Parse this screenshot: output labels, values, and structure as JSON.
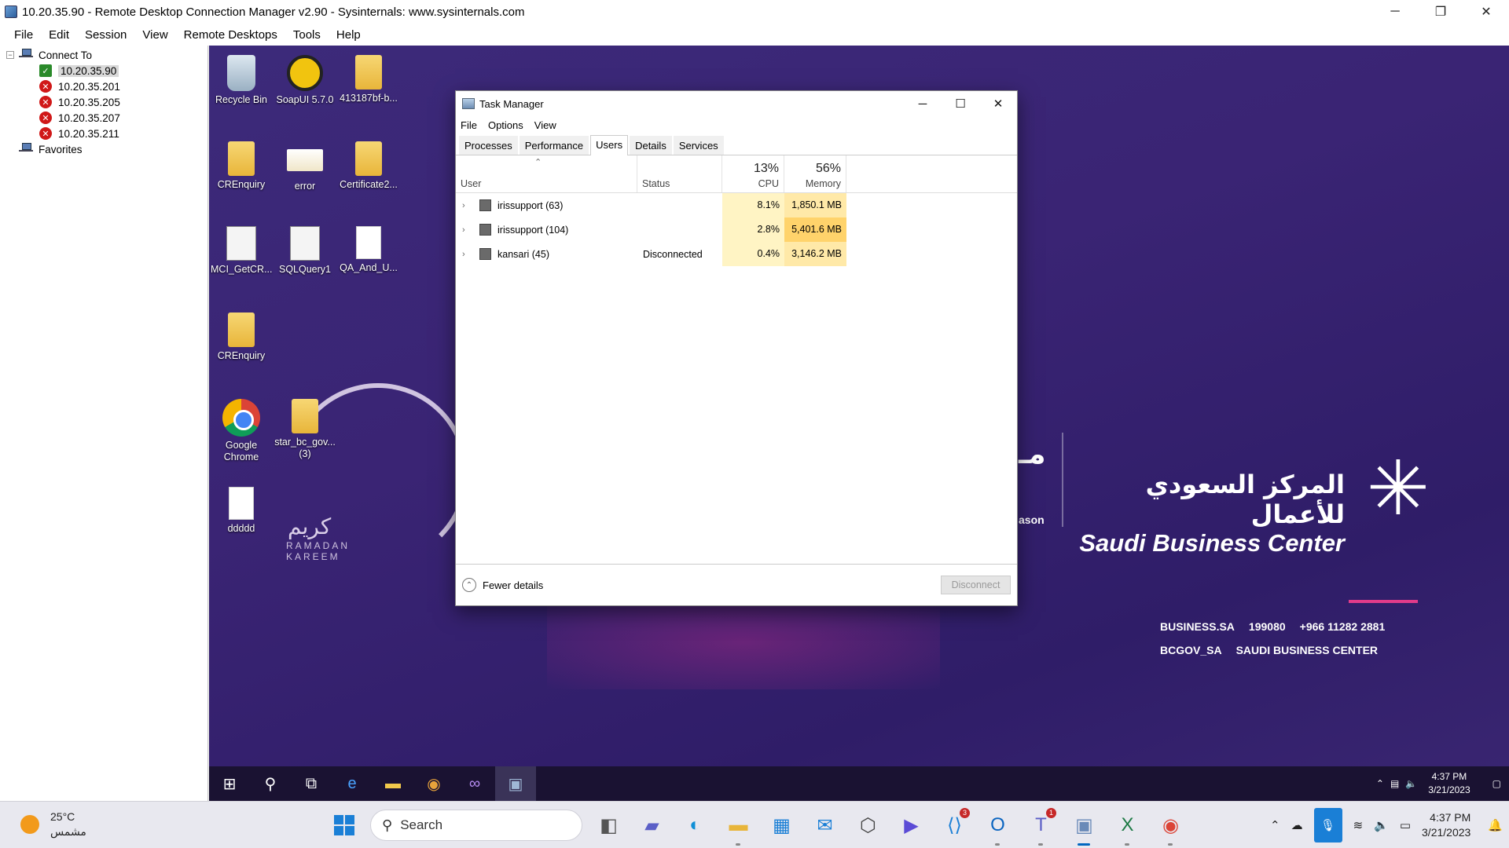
{
  "window": {
    "title": "10.20.35.90 - Remote Desktop Connection Manager v2.90 - Sysinternals: www.sysinternals.com",
    "minimize": "─",
    "restore": "❐",
    "close": "✕"
  },
  "menu": [
    "File",
    "Edit",
    "Session",
    "View",
    "Remote Desktops",
    "Tools",
    "Help"
  ],
  "tree": {
    "root_label": "Connect To",
    "servers": [
      {
        "label": "10.20.35.90",
        "status": "connected"
      },
      {
        "label": "10.20.35.201",
        "status": "error"
      },
      {
        "label": "10.20.35.205",
        "status": "error"
      },
      {
        "label": "10.20.35.207",
        "status": "error"
      },
      {
        "label": "10.20.35.211",
        "status": "error"
      }
    ],
    "favorites_label": "Favorites"
  },
  "desktop": {
    "icons": [
      {
        "label": "Recycle Bin",
        "icon": "recycle-bin-icon"
      },
      {
        "label": "SoapUI 5.7.0",
        "icon": "soapui-icon"
      },
      {
        "label": "413187bf-b...",
        "icon": "folder-icon"
      },
      {
        "label": "CREnquiry",
        "icon": "folder-icon"
      },
      {
        "label": "error",
        "icon": "card-icon"
      },
      {
        "label": "Certificate2...",
        "icon": "folder-icon"
      },
      {
        "label": "MCI_GetCR...",
        "icon": "sql-file-icon"
      },
      {
        "label": "SQLQuery1",
        "icon": "sql-file-icon"
      },
      {
        "label": "QA_And_U...",
        "icon": "document-icon"
      },
      {
        "label": "CREnquiry",
        "icon": "zip-folder-icon"
      },
      {
        "label": "Google Chrome",
        "icon": "chrome-icon"
      },
      {
        "label": "star_bc_gov... (3)",
        "icon": "zip-folder-icon"
      },
      {
        "label": "ddddd",
        "icon": "document-icon"
      }
    ],
    "ramadan_arabic": "كريم",
    "ramadan_text": "RAMADAN KAREEM",
    "season_fragment": "مـ",
    "season_text": "ason",
    "sbc_arabic": "المركز السعودي للأعمال",
    "sbc_english": "Saudi Business Center",
    "contact_row1": [
      "BUSINESS.SA",
      "199080",
      "+966 11282 2881"
    ],
    "contact_row2": [
      "BCGOV_SA",
      "SAUDI BUSINESS CENTER"
    ]
  },
  "task_manager": {
    "title": "Task Manager",
    "menu": [
      "File",
      "Options",
      "View"
    ],
    "tabs": [
      "Processes",
      "Performance",
      "Users",
      "Details",
      "Services"
    ],
    "active_tab": "Users",
    "columns": {
      "user": "User",
      "status": "Status",
      "cpu_label": "CPU",
      "cpu_pct": "13%",
      "mem_label": "Memory",
      "mem_pct": "56%"
    },
    "rows": [
      {
        "user": "irissupport (63)",
        "status": "",
        "cpu": "8.1%",
        "memory": "1,850.1 MB"
      },
      {
        "user": "irissupport (104)",
        "status": "",
        "cpu": "2.8%",
        "memory": "5,401.6 MB"
      },
      {
        "user": "kansari (45)",
        "status": "Disconnected",
        "cpu": "0.4%",
        "memory": "3,146.2 MB"
      }
    ],
    "fewer_details": "Fewer details",
    "disconnect": "Disconnect"
  },
  "remote_taskbar": {
    "clock_time": "4:37 PM",
    "clock_date": "3/21/2023"
  },
  "host_taskbar": {
    "temperature": "25°C",
    "weather_desc": "مشمس",
    "search_label": "Search",
    "clock_time": "4:37 PM",
    "clock_date": "3/21/2023",
    "badges": {
      "vscode": "3",
      "teams": "1"
    }
  }
}
